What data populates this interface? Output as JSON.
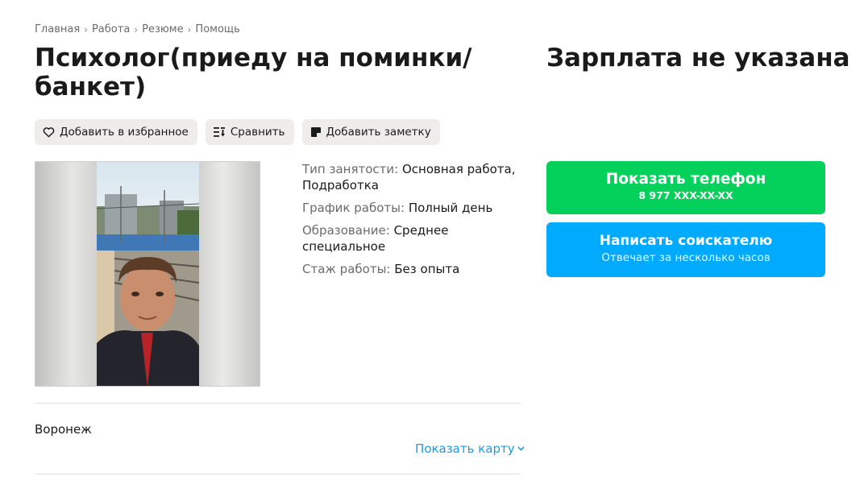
{
  "breadcrumb": {
    "items": [
      "Главная",
      "Работа",
      "Резюме",
      "Помощь"
    ]
  },
  "title": "Психолог(приеду на поминки/ банкет)",
  "salary": "Зарплата не указана",
  "actions": {
    "favorite": "Добавить в избранное",
    "compare": "Сравнить",
    "note": "Добавить заметку"
  },
  "details": {
    "employment_label": "Тип занятости:",
    "employment_value": "Основная работа, Подработка",
    "schedule_label": "График работы:",
    "schedule_value": "Полный день",
    "education_label": "Образование:",
    "education_value": "Среднее специальное",
    "experience_label": "Стаж работы:",
    "experience_value": "Без опыта"
  },
  "location": {
    "city": "Воронеж",
    "show_map": "Показать карту"
  },
  "contact": {
    "phone_button": "Показать телефон",
    "phone_masked": "8 977 XXX-XX-XX",
    "write_button": "Написать соискателю",
    "write_sub": "Отвечает за несколько часов"
  },
  "colors": {
    "phone_button": "#04d15c",
    "write_button": "#00aaff",
    "link": "#1a9be6",
    "action_bg": "#efede9"
  }
}
